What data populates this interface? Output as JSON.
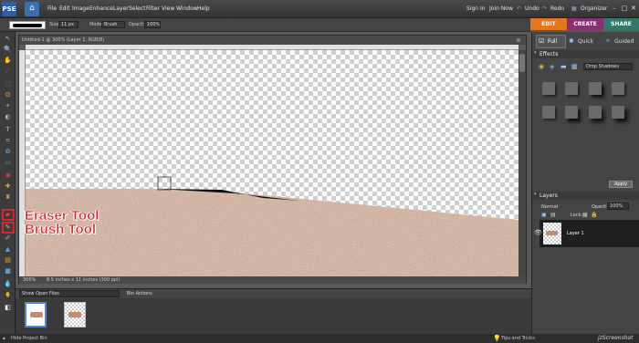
{
  "app": {
    "logo": "PSE"
  },
  "menu": [
    "File",
    "Edit",
    "Image",
    "Enhance",
    "Layer",
    "Select",
    "Filter",
    "View",
    "Window",
    "Help"
  ],
  "menubar_right": {
    "signin": "Sign In",
    "join": "Join Now",
    "undo": "Undo",
    "redo": "Redo",
    "organizer": "Organizer"
  },
  "modetabs": {
    "edit": "EDIT",
    "create": "CREATE",
    "share": "SHARE"
  },
  "options": {
    "size_label": "Size:",
    "size_value": "11 px",
    "mode_label": "Mode:",
    "mode_value": "Brush",
    "opacity_label": "Opacity:",
    "opacity_value": "100%"
  },
  "document": {
    "title": "Untitled-1 @ 300% (Layer 1, RGB/8)",
    "zoom": "300%",
    "info": "8.5 inches x 11 inches (300 ppi)"
  },
  "bin": {
    "show_label": "Show Open Files",
    "actions": "Bin Actions",
    "hide_label": "Hide Project Bin"
  },
  "right": {
    "views": {
      "full": "Full",
      "quick": "Quick",
      "guided": "Guided"
    },
    "effects_title": "Effects",
    "effects_dropdown": "Drop Shadows",
    "apply": "Apply",
    "layers_title": "Layers",
    "blend_mode": "Normal",
    "opacity_label": "Opacity:",
    "opacity_value": "100%",
    "lock_label": "Lock:",
    "layer_name": "Layer 1"
  },
  "annotations": {
    "eraser": "Eraser Tool",
    "brush": "Brush Tool"
  },
  "footer": {
    "tips": "Tips and Tricks",
    "watermark": "jzScreenshot"
  }
}
